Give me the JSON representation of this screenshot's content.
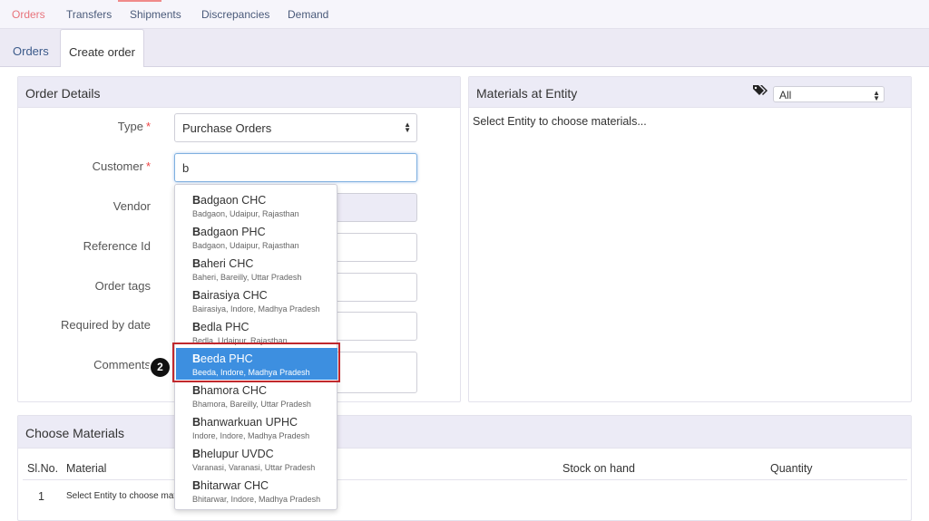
{
  "top_nav": {
    "tabs": [
      "Orders",
      "Transfers",
      "Shipments",
      "Discrepancies",
      "Demand"
    ]
  },
  "sub_tabs": [
    "Orders",
    "Create order"
  ],
  "order_details": {
    "title": "Order Details",
    "type_label": "Type",
    "type_value": "Purchase Orders",
    "customer_label": "Customer",
    "customer_value": "b",
    "vendor_label": "Vendor",
    "reference_label": "Reference Id",
    "tags_label": "Order tags",
    "required_date_label": "Required by date",
    "comments_label": "Comments",
    "required_mark": "*"
  },
  "materials_at_entity": {
    "title": "Materials at Entity",
    "filter_value": "All",
    "message": "Select Entity to choose materials..."
  },
  "choose_materials": {
    "title": "Choose Materials",
    "columns": [
      "Sl.No.",
      "Material",
      "Stock on hand",
      "Quantity"
    ],
    "row_number": "1",
    "row_text": "Select Entity to choose mate"
  },
  "customer_suggestions": [
    {
      "first": "B",
      "rest": "adgaon CHC",
      "location": "Badgaon, Udaipur, Rajasthan"
    },
    {
      "first": "B",
      "rest": "adgaon PHC",
      "location": "Badgaon, Udaipur, Rajasthan"
    },
    {
      "first": "B",
      "rest": "aheri CHC",
      "location": "Baheri, Bareilly, Uttar Pradesh"
    },
    {
      "first": "B",
      "rest": "airasiya CHC",
      "location": "Bairasiya, Indore, Madhya Pradesh"
    },
    {
      "first": "B",
      "rest": "edla PHC",
      "location": "Bedla, Udaipur, Rajasthan"
    },
    {
      "first": "B",
      "rest": "eeda PHC",
      "location": "Beeda, Indore, Madhya Pradesh"
    },
    {
      "first": "B",
      "rest": "hamora CHC",
      "location": "Bhamora, Bareilly, Uttar Pradesh"
    },
    {
      "first": "B",
      "rest": "hanwarkuan UPHC",
      "location": "Indore, Indore, Madhya Pradesh"
    },
    {
      "first": "B",
      "rest": "helupur UVDC",
      "location": "Varanasi, Varanasi, Uttar Pradesh"
    },
    {
      "first": "B",
      "rest": "hitarwar CHC",
      "location": "Bhitarwar, Indore, Madhya Pradesh"
    }
  ],
  "selected_index": 5,
  "step_marker": "2",
  "colors": {
    "active_tab": "#e8747c",
    "selected_option": "#3d8fe0",
    "highlight_box": "#c0282d"
  }
}
